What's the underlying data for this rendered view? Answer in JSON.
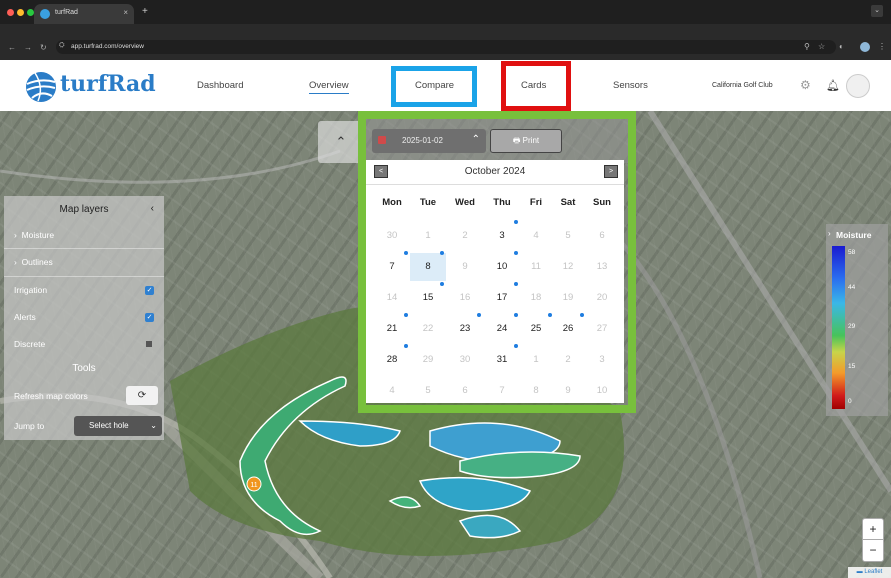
{
  "browser": {
    "tab_title": "turfRad",
    "tab_close": "×",
    "new_tab": "+",
    "url": "app.turfrad.com/overview",
    "window_colors": [
      "#ff5f57",
      "#febc2e",
      "#28c840"
    ]
  },
  "app": {
    "logo_text": "turfRad",
    "nav": {
      "dashboard": "Dashboard",
      "overview": "Overview",
      "compare": "Compare",
      "cards": "Cards",
      "sensors": "Sensors"
    },
    "club_name": "California Golf Club",
    "accent": "#2a7cc7",
    "highlight_colors": {
      "compare": "#1aa3e8",
      "cards": "#e01010",
      "calendar": "#78c03c"
    }
  },
  "toolbar": {
    "selected_date": "2025-01-02",
    "print_label": "Print",
    "collapse_icon": "chevron-up-icon"
  },
  "calendar": {
    "month_label": "October 2024",
    "prev_label": "<",
    "next_label": ">",
    "weekdays": [
      "Mon",
      "Tue",
      "Wed",
      "Thu",
      "Fri",
      "Sat",
      "Sun"
    ],
    "weeks": [
      [
        {
          "d": "30",
          "m": false
        },
        {
          "d": "1",
          "m": false
        },
        {
          "d": "2",
          "m": false
        },
        {
          "d": "3",
          "m": true,
          "dot": true
        },
        {
          "d": "4",
          "m": false
        },
        {
          "d": "5",
          "m": false
        },
        {
          "d": "6",
          "m": false
        }
      ],
      [
        {
          "d": "7",
          "m": true,
          "dot": true
        },
        {
          "d": "8",
          "m": true,
          "dot": true,
          "sel": true
        },
        {
          "d": "9",
          "m": false
        },
        {
          "d": "10",
          "m": true,
          "dot": true
        },
        {
          "d": "11",
          "m": false
        },
        {
          "d": "12",
          "m": false
        },
        {
          "d": "13",
          "m": false
        }
      ],
      [
        {
          "d": "14",
          "m": false
        },
        {
          "d": "15",
          "m": true,
          "dot": true
        },
        {
          "d": "16",
          "m": false
        },
        {
          "d": "17",
          "m": true,
          "dot": true
        },
        {
          "d": "18",
          "m": false
        },
        {
          "d": "19",
          "m": false
        },
        {
          "d": "20",
          "m": false
        }
      ],
      [
        {
          "d": "21",
          "m": true,
          "dot": true
        },
        {
          "d": "22",
          "m": false
        },
        {
          "d": "23",
          "m": true,
          "dot": true
        },
        {
          "d": "24",
          "m": true,
          "dot": true
        },
        {
          "d": "25",
          "m": true,
          "dot": true
        },
        {
          "d": "26",
          "m": true,
          "dot": true
        },
        {
          "d": "27",
          "m": false
        }
      ],
      [
        {
          "d": "28",
          "m": true,
          "dot": true
        },
        {
          "d": "29",
          "m": false
        },
        {
          "d": "30",
          "m": false
        },
        {
          "d": "31",
          "m": true,
          "dot": true
        },
        {
          "d": "1",
          "m": false
        },
        {
          "d": "2",
          "m": false
        },
        {
          "d": "3",
          "m": false
        }
      ],
      [
        {
          "d": "4",
          "m": false
        },
        {
          "d": "5",
          "m": false
        },
        {
          "d": "6",
          "m": false
        },
        {
          "d": "7",
          "m": false
        },
        {
          "d": "8",
          "m": false
        },
        {
          "d": "9",
          "m": false
        },
        {
          "d": "10",
          "m": false
        }
      ]
    ]
  },
  "layers": {
    "title": "Map layers",
    "items": [
      {
        "label": "Moisture",
        "kind": "expand"
      },
      {
        "label": "Outlines",
        "kind": "expand"
      },
      {
        "label": "Irrigation",
        "kind": "checkbox",
        "checked": true
      },
      {
        "label": "Alerts",
        "kind": "checkbox",
        "checked": true
      },
      {
        "label": "Discrete",
        "kind": "square"
      }
    ],
    "tools_title": "Tools",
    "refresh_label": "Refresh map colors",
    "jump_label": "Jump to",
    "jump_value": "Select hole"
  },
  "moisture_legend": {
    "title": "Moisture",
    "ticks": [
      "58",
      "44",
      "29",
      "15",
      "0"
    ]
  },
  "map": {
    "hole_marker": "11",
    "zoom_in": "+",
    "zoom_out": "−",
    "attribution": "Leaflet"
  }
}
